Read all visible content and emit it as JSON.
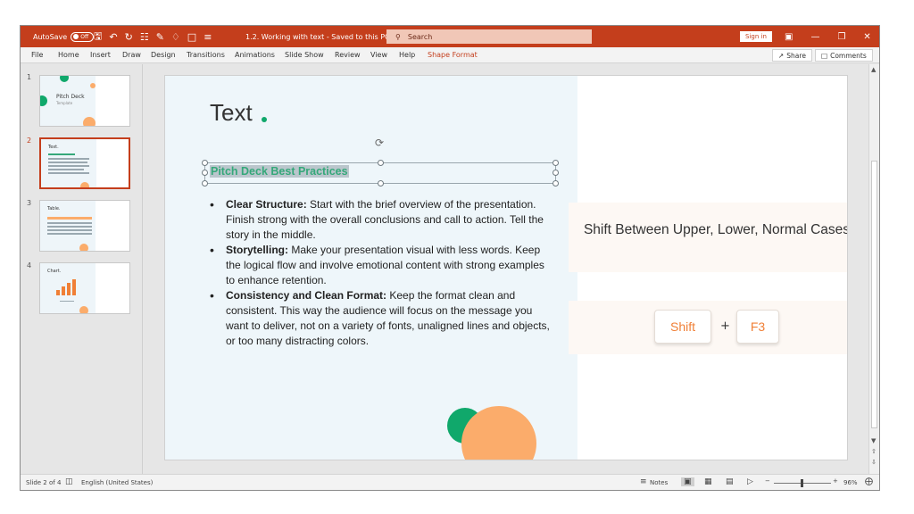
{
  "titlebar": {
    "autosave_label": "AutoSave",
    "autosave_state": "Off",
    "doc_title": "1.2. Working with text - Saved to this PC",
    "search_placeholder": "Search",
    "signin_label": "Sign in"
  },
  "menu": {
    "items": [
      "File",
      "Home",
      "Insert",
      "Draw",
      "Design",
      "Transitions",
      "Animations",
      "Slide Show",
      "Review",
      "View",
      "Help",
      "Shape Format"
    ],
    "share_label": "Share",
    "comments_label": "Comments"
  },
  "thumbnails": [
    {
      "num": "1",
      "title": "Pitch Deck",
      "subtitle": "Template"
    },
    {
      "num": "2",
      "title": "Text."
    },
    {
      "num": "3",
      "title": "Table."
    },
    {
      "num": "4",
      "title": "Chart."
    }
  ],
  "slide": {
    "title": "Text",
    "subtitle": "Pitch Deck Best Practices",
    "bullets": [
      {
        "head": "Clear Structure:",
        "body": " Start with the brief overview of the presentation. Finish strong with the overall conclusions and call to action. Tell the story in the middle."
      },
      {
        "head": "Storytelling:",
        "body": " Make your presentation visual with less words. Keep the logical flow and involve emotional content with strong examples to enhance retention."
      },
      {
        "head": "Consistency and Clean Format:",
        "body": " Keep the format clean and consistent. This way the audience will focus on the message you want to deliver, not on a variety of fonts, unaligned lines and objects, or too many distracting colors."
      }
    ],
    "shortcut_title": "Shift Between Upper, Lower, Normal Cases",
    "key1": "Shift",
    "plus": "+",
    "key2": "F3"
  },
  "status": {
    "slide_info": "Slide 2 of 4",
    "language": "English (United States)",
    "notes_label": "Notes",
    "zoom": "96%"
  },
  "colors": {
    "accent": "#c43e1c",
    "green": "#10a86b",
    "orange": "#fbac6b"
  }
}
